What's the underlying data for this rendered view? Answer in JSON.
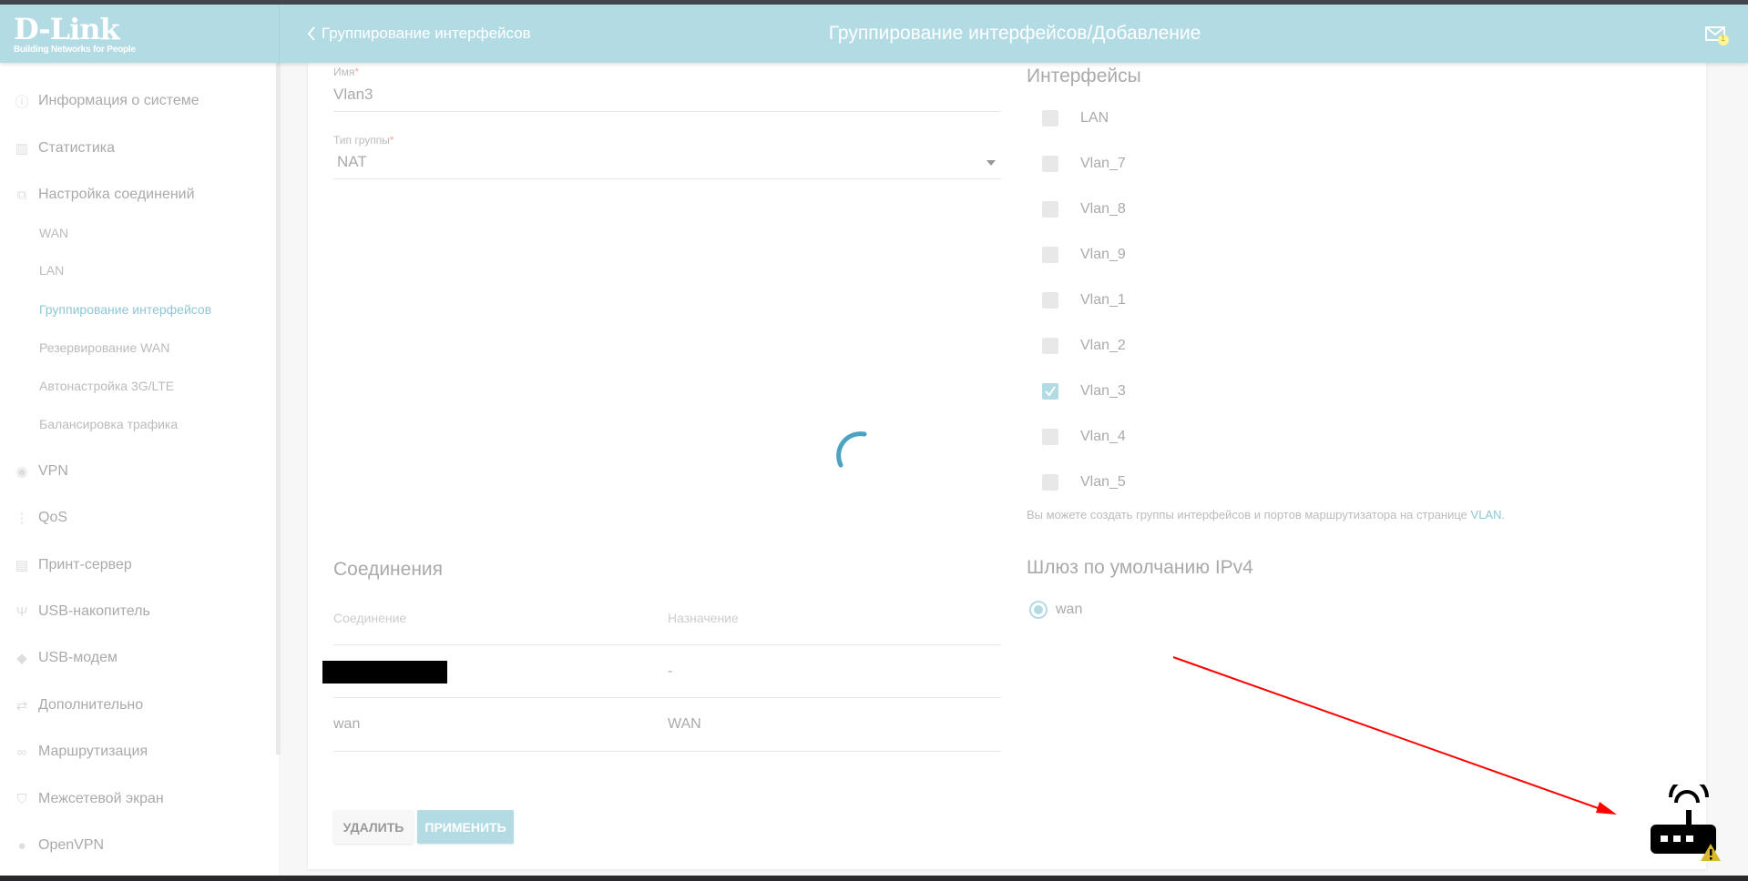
{
  "header": {
    "logo_main": "D-Link",
    "logo_tagline": "Building Networks for People",
    "back_label": "Группирование интерфейсов",
    "title": "Группирование интерфейсов/Добавление",
    "notification_count": "1"
  },
  "sidebar": {
    "items": [
      {
        "label": "Информация о системе",
        "icon": "info-icon"
      },
      {
        "label": "Статистика",
        "icon": "chart-icon"
      },
      {
        "label": "Настройка соединений",
        "icon": "connections-icon"
      },
      {
        "label": "WAN",
        "sub": true
      },
      {
        "label": "LAN",
        "sub": true
      },
      {
        "label": "Группирование интерфейсов",
        "sub": true,
        "active": true
      },
      {
        "label": "Резервирование WAN",
        "sub": true
      },
      {
        "label": "Автонастройка 3G/LTE",
        "sub": true
      },
      {
        "label": "Балансировка трафика",
        "sub": true
      },
      {
        "label": "VPN",
        "icon": "lock-icon"
      },
      {
        "label": "QoS",
        "icon": "qos-icon"
      },
      {
        "label": "Принт-сервер",
        "icon": "printer-icon"
      },
      {
        "label": "USB-накопитель",
        "icon": "usb-icon"
      },
      {
        "label": "USB-модем",
        "icon": "usb-modem-icon"
      },
      {
        "label": "Дополнительно",
        "icon": "arrows-icon"
      },
      {
        "label": "Маршрутизация",
        "icon": "routing-icon"
      },
      {
        "label": "Межсетевой экран",
        "icon": "shield-icon"
      },
      {
        "label": "OpenVPN",
        "icon": "openvpn-icon"
      }
    ]
  },
  "form": {
    "name_label": "Имя",
    "name_value": "Vlan3",
    "type_label": "Тип группы",
    "type_value": "NAT",
    "required_mark": "*"
  },
  "connections": {
    "title": "Соединения",
    "col_connection": "Соединение",
    "col_purpose": "Назначение",
    "rows": [
      {
        "connection": "",
        "purpose": "-"
      },
      {
        "connection": "wan",
        "purpose": "WAN"
      }
    ]
  },
  "buttons": {
    "delete": "УДАЛИТЬ",
    "apply": "ПРИМЕНИТЬ"
  },
  "interfaces": {
    "title": "Интерфейсы",
    "items": [
      {
        "label": "LAN",
        "checked": false
      },
      {
        "label": "Vlan_7",
        "checked": false
      },
      {
        "label": "Vlan_8",
        "checked": false
      },
      {
        "label": "Vlan_9",
        "checked": false
      },
      {
        "label": "Vlan_1",
        "checked": false
      },
      {
        "label": "Vlan_2",
        "checked": false
      },
      {
        "label": "Vlan_3",
        "checked": true
      },
      {
        "label": "Vlan_4",
        "checked": false
      },
      {
        "label": "Vlan_5",
        "checked": false
      }
    ],
    "note": "Вы можете создать группы интерфейсов и портов маршрутизатора на странице ",
    "note_link": "VLAN",
    "note_end": "."
  },
  "gateway": {
    "title": "Шлюз по умолчанию IPv4",
    "option": "wan",
    "selected": true
  },
  "colors": {
    "accent": "#b3dbe4",
    "spinner": "#4aa3c0",
    "annotation": "#ff0000",
    "warning": "#d9b92a"
  }
}
